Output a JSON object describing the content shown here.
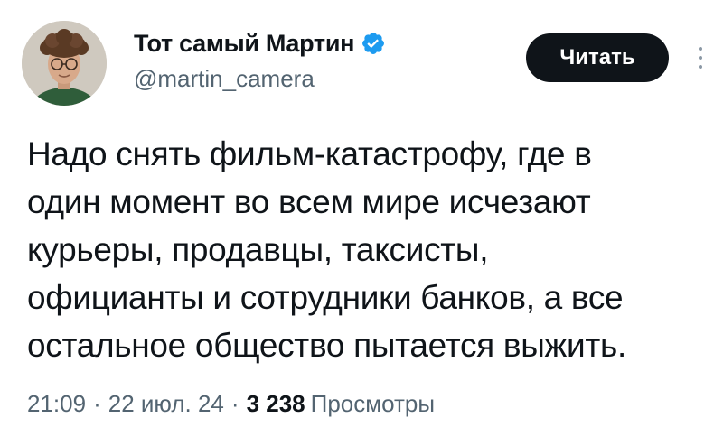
{
  "author": {
    "display_name": "Тот самый Мартин",
    "handle": "@martin_camera",
    "verified": true
  },
  "follow_button": {
    "label": "Читать"
  },
  "tweet": {
    "lines": [
      "Надо снять фильм-катастрофу, где в",
      "один момент во всем мире исчезают",
      "курьеры, продавцы, таксисты,",
      "официанты и сотрудники банков, а все",
      "остальное общество пытается выжить."
    ]
  },
  "meta": {
    "time": "21:09",
    "separator": "·",
    "date": "22 июл. 24",
    "views_count": "3 238",
    "views_label": "Просмотры"
  },
  "colors": {
    "text": "#0f1419",
    "secondary": "#536471",
    "verified_badge": "#1d9bf0",
    "button_bg": "#0f1419"
  },
  "icons": {
    "verified": "verified-badge-icon",
    "more": "more-options-icon"
  }
}
